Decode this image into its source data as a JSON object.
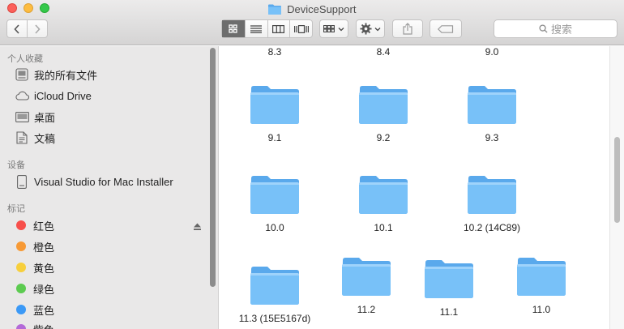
{
  "window": {
    "title": "DeviceSupport"
  },
  "search": {
    "placeholder": "搜索"
  },
  "sidebar": {
    "favorites_header": "个人收藏",
    "favorites": [
      {
        "label": "我的所有文件",
        "icon": "all-files-icon"
      },
      {
        "label": "iCloud Drive",
        "icon": "cloud-icon"
      },
      {
        "label": "桌面",
        "icon": "desktop-icon"
      },
      {
        "label": "文稿",
        "icon": "document-icon"
      }
    ],
    "devices_header": "设备",
    "devices": [
      {
        "label": "Visual Studio for Mac Installer",
        "icon": "disk-icon"
      }
    ],
    "tags_header": "标记",
    "tags": [
      {
        "label": "红色",
        "color": "#f74f4b"
      },
      {
        "label": "橙色",
        "color": "#f79a36"
      },
      {
        "label": "黄色",
        "color": "#f7cf3c"
      },
      {
        "label": "绿色",
        "color": "#5ccb50"
      },
      {
        "label": "蓝色",
        "color": "#3b99f6"
      },
      {
        "label": "紫色",
        "color": "#b36ad8"
      }
    ]
  },
  "main": {
    "partial_top_row": [
      "8.3",
      "8.4",
      "9.0"
    ],
    "folders": [
      {
        "label": "9.1"
      },
      {
        "label": "9.2"
      },
      {
        "label": "9.3"
      },
      {
        "label": "10.0"
      },
      {
        "label": "10.1"
      },
      {
        "label": "10.2 (14C89)"
      },
      {
        "label": "11.3 (15E5167d)"
      },
      {
        "label": "11.2"
      },
      {
        "label": "11.1"
      },
      {
        "label": "11.0"
      }
    ]
  },
  "colors": {
    "folder": "#6bb7f5",
    "folder_tab": "#5aa9ec",
    "folder_front": "#78c1f8"
  }
}
